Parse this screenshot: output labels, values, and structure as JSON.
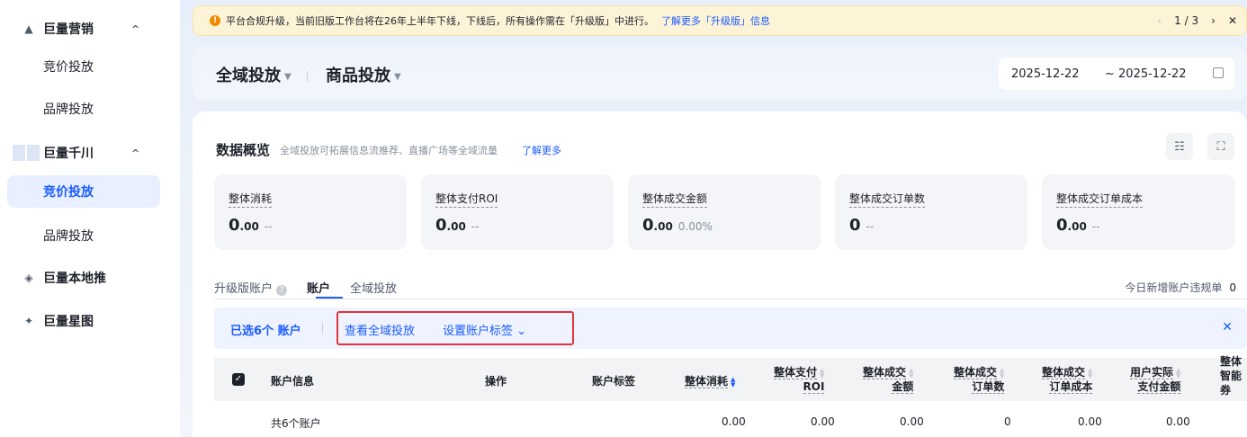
{
  "sidebar": {
    "groups": [
      {
        "label": "巨量营销",
        "icon": "a-icon",
        "subs": [
          "竞价投放",
          "品牌投放"
        ]
      },
      {
        "label": "巨量千川",
        "icon": "qianchuan-logo",
        "subs": [
          "竞价投放",
          "品牌投放"
        ],
        "active_sub": 0
      },
      {
        "label": "巨量本地推",
        "icon": "diamond-icon"
      },
      {
        "label": "巨量星图",
        "icon": "star-icon"
      }
    ],
    "chevron": "^"
  },
  "notice": {
    "text": "平台合规升级，当前旧版工作台将在26年上半年下线，下线后，所有操作需在「升级版」中进行。",
    "link": "了解更多「升级版」信息",
    "page": "1 / 3"
  },
  "header": {
    "title": "全域投放",
    "subtitle": "商品投放",
    "date_start": "2025-12-22",
    "date_end": "~ 2025-12-22"
  },
  "overview": {
    "title": "数据概览",
    "desc": "全域投放可拓展信息流推荐、直播广场等全域流量",
    "link": "了解更多",
    "metrics": [
      {
        "label": "整体消耗",
        "value_int": "0",
        "value_dec": ".00",
        "compare": "--"
      },
      {
        "label": "整体支付ROI",
        "value_int": "0",
        "value_dec": ".00",
        "compare": "--"
      },
      {
        "label": "整体成交金额",
        "value_int": "0",
        "value_dec": ".00",
        "compare": "0.00%"
      },
      {
        "label": "整体成交订单数",
        "value_int": "0",
        "value_dec": "",
        "compare": "--"
      },
      {
        "label": "整体成交订单成本",
        "value_int": "0",
        "value_dec": ".00",
        "compare": "--"
      }
    ]
  },
  "tabs": [
    "升级版账户",
    "账户",
    "全域投放"
  ],
  "violation": {
    "label": "今日新增账户违规单",
    "count": "0"
  },
  "selection": {
    "count_label": "已选6个 账户",
    "action_view": "查看全域投放",
    "action_tag": "设置账户标签"
  },
  "table": {
    "headers": {
      "account": "账户信息",
      "operation": "操作",
      "tag": "账户标签",
      "cost": "整体消耗",
      "roi_1": "整体支付",
      "roi_2": "ROI",
      "gmv_1": "整体成交",
      "gmv_2": "金额",
      "orders_1": "整体成交",
      "orders_2": "订单数",
      "order_cost_1": "整体成交",
      "order_cost_2": "订单成本",
      "paid_1": "用户实际",
      "paid_2": "支付金额",
      "smart_1": "整体",
      "smart_2": "智能",
      "smart_3": "券"
    },
    "summary": {
      "label": "共6个账户",
      "cost": "0.00",
      "roi": "0.00",
      "gmv": "0.00",
      "orders": "0",
      "order_cost": "0.00",
      "paid": "0.00"
    }
  }
}
